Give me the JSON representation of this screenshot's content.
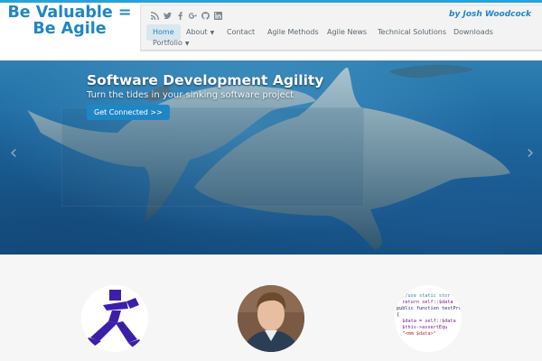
{
  "header": {
    "site_title": "Be Valuable =\nBe Agile",
    "byline": "by Josh Woodcock",
    "social_icons": [
      "rss-icon",
      "twitter-icon",
      "facebook-icon",
      "google-plus-icon",
      "github-icon",
      "linkedin-icon"
    ]
  },
  "nav": {
    "items": [
      {
        "label": "Home",
        "active": true
      },
      {
        "label": "About",
        "dropdown": true
      },
      {
        "label": "Contact"
      },
      {
        "label": "Agile Methods"
      },
      {
        "label": "Agile News"
      },
      {
        "label": "Technical Solutions"
      },
      {
        "label": "Downloads"
      },
      {
        "label": "Portfolio",
        "dropdown": true
      }
    ]
  },
  "hero": {
    "title": "Software Development Agility",
    "subtitle": "Turn the tides in your sinking software project",
    "button_label": "Get Connected >>",
    "prev_arrow": "‹",
    "next_arrow": "›"
  },
  "features": {
    "code_lines": [
      "                  );",
      "  //use static stor",
      "  return self::$data",
      "",
      "public function testPro",
      "{",
      "  $data = self::$data",
      "  $this->assertEqu",
      "",
      "  \"<mm $data>\""
    ]
  },
  "colors": {
    "brand": "#1f86c5",
    "top_bar": "#27a3d7",
    "logo_purple": "#3c1fa8"
  }
}
